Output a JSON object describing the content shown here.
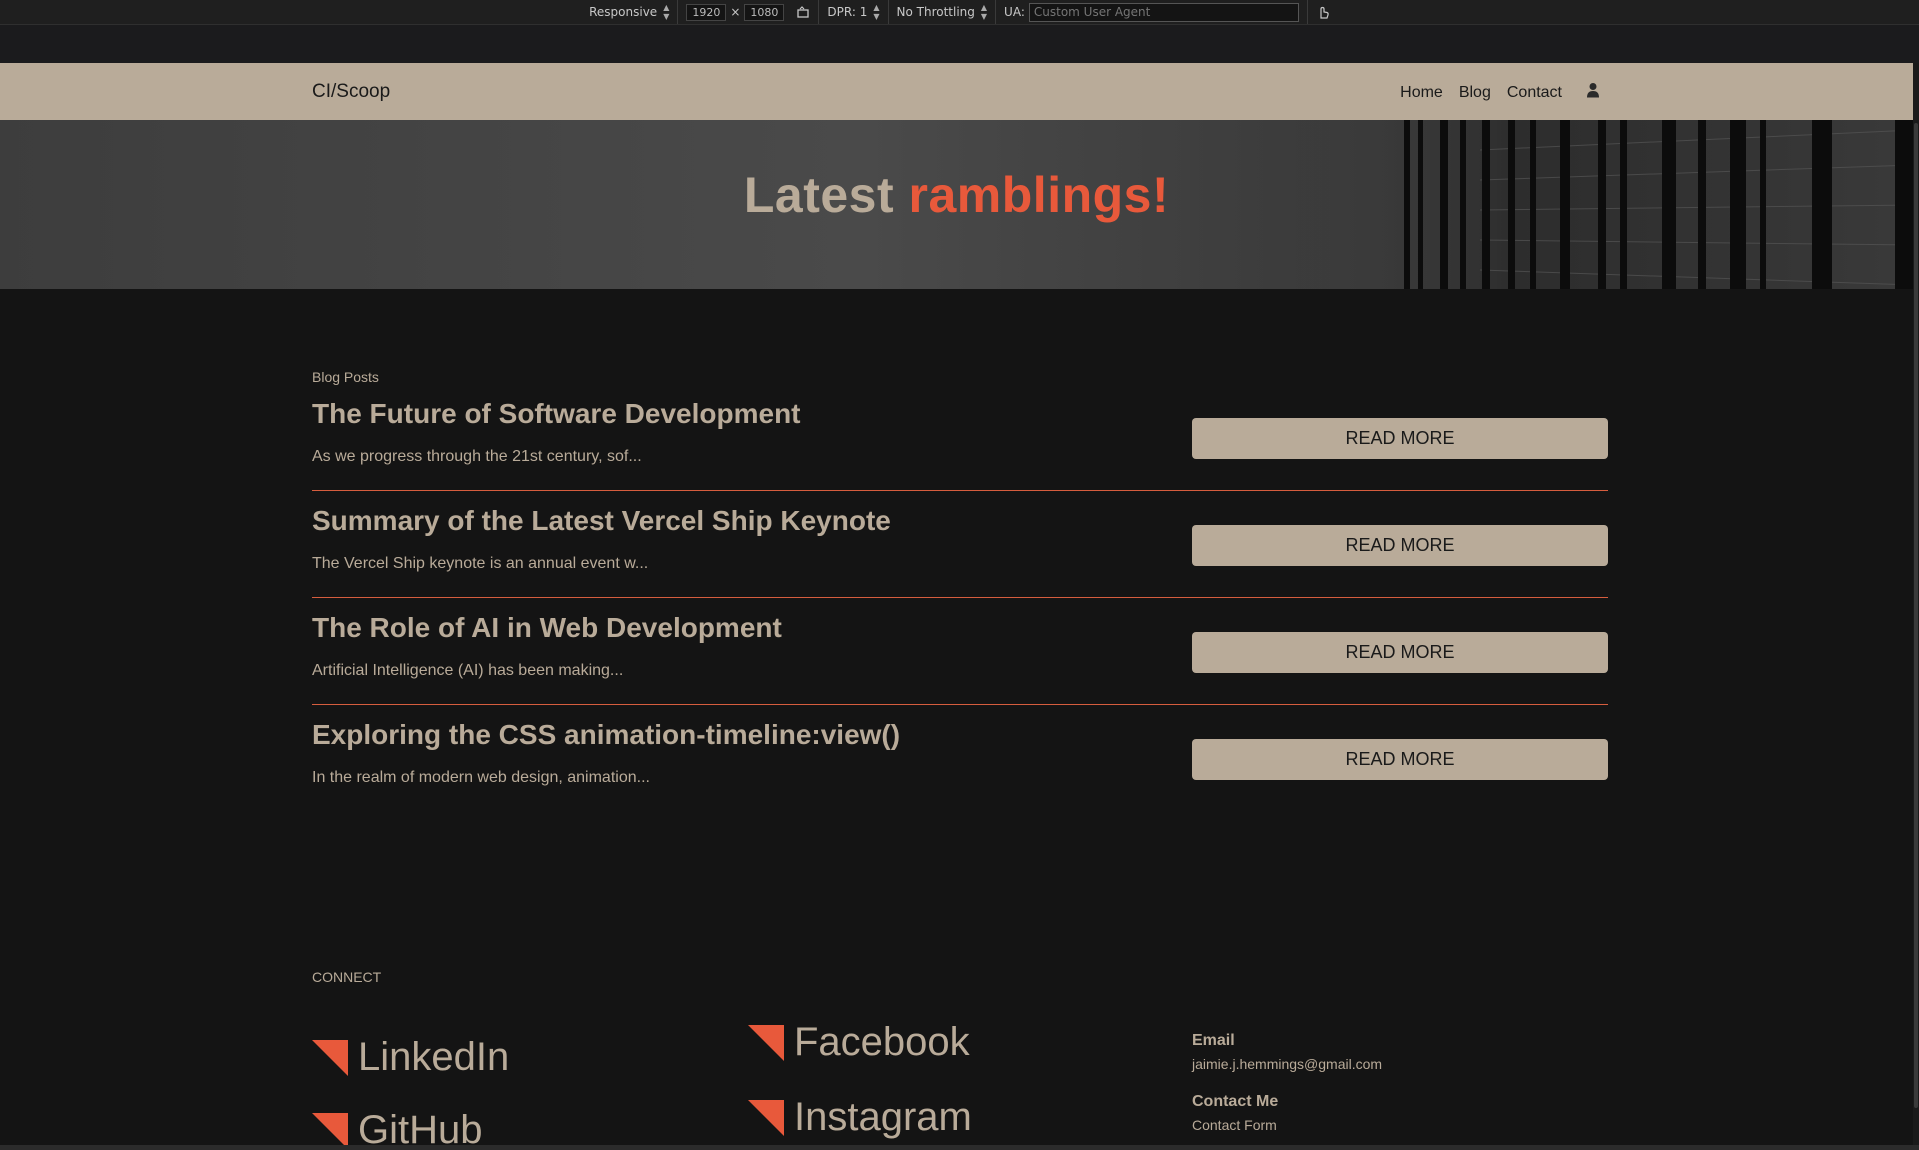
{
  "devtools": {
    "device": "Responsive",
    "width": "1920",
    "height": "1080",
    "dpr": "DPR: 1",
    "throttling": "No Throttling",
    "ua_label": "UA:",
    "ua_placeholder": "Custom User Agent"
  },
  "navbar": {
    "brand": "CI/Scoop",
    "links": [
      "Home",
      "Blog",
      "Contact"
    ]
  },
  "hero": {
    "title_start": "Latest",
    "title_accent": "ramblings!"
  },
  "blog": {
    "section_label": "Blog Posts",
    "posts": [
      {
        "title": "The Future of Software Development",
        "excerpt": "As we progress through the 21st century, sof...",
        "button": "READ MORE"
      },
      {
        "title": "Summary of the Latest Vercel Ship Keynote",
        "excerpt": "The Vercel Ship keynote is an annual event w...",
        "button": "READ MORE"
      },
      {
        "title": "The Role of AI in Web Development",
        "excerpt": "Artificial Intelligence (AI) has been making...",
        "button": "READ MORE"
      },
      {
        "title": "Exploring the CSS animation-timeline:view()",
        "excerpt": "In the realm of modern web design, animation...",
        "button": "READ MORE"
      }
    ]
  },
  "connect": {
    "section_label": "CONNECT",
    "socials": [
      "LinkedIn",
      "Facebook",
      "GitHub",
      "Instagram"
    ],
    "email_heading": "Email",
    "email_value": "jaimie.j.hemmings@gmail.com",
    "contact_heading": "Contact Me",
    "contact_value": "Contact Form"
  },
  "colors": {
    "accent": "#e8593b",
    "tan": "#b9ab99",
    "background": "#141414"
  }
}
